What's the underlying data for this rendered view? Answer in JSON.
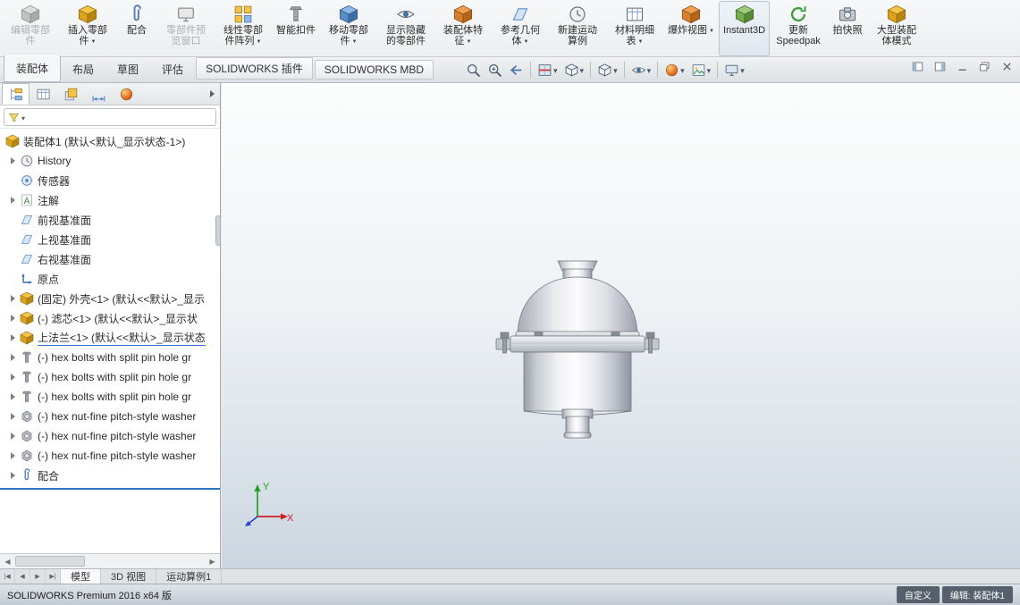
{
  "command_bar": {
    "buttons": [
      {
        "label": "编辑零部件",
        "icon": "edit-component-icon",
        "disabled": true,
        "dropdown": false
      },
      {
        "label": "插入零部件",
        "icon": "insert-component-icon",
        "disabled": false,
        "dropdown": true
      },
      {
        "label": "配合",
        "icon": "mate-icon",
        "disabled": false,
        "dropdown": false
      },
      {
        "label": "零部件预览窗口",
        "icon": "component-preview-window-icon",
        "disabled": true,
        "dropdown": false
      },
      {
        "label": "线性零部件阵列",
        "icon": "linear-component-pattern-icon",
        "disabled": false,
        "dropdown": true
      },
      {
        "label": "智能扣件",
        "icon": "smart-fasteners-icon",
        "disabled": false,
        "dropdown": false
      },
      {
        "label": "移动零部件",
        "icon": "move-component-icon",
        "disabled": false,
        "dropdown": true
      },
      {
        "label": "显示隐藏的零部件",
        "icon": "show-hidden-components-icon",
        "disabled": false,
        "dropdown": false
      },
      {
        "label": "装配体特征",
        "icon": "assembly-features-icon",
        "disabled": false,
        "dropdown": true
      },
      {
        "label": "参考几何体",
        "icon": "reference-geometry-icon",
        "disabled": false,
        "dropdown": true
      },
      {
        "label": "新建运动算例",
        "icon": "new-motion-study-icon",
        "disabled": false,
        "dropdown": false
      },
      {
        "label": "材料明细表",
        "icon": "bill-of-materials-icon",
        "disabled": false,
        "dropdown": true
      },
      {
        "label": "爆炸视图",
        "icon": "exploded-view-icon",
        "disabled": false,
        "dropdown": true
      },
      {
        "label": "Instant3D",
        "icon": "instant3d-icon",
        "disabled": false,
        "dropdown": false
      },
      {
        "label": "更新 Speedpak",
        "icon": "update-speedpak-icon",
        "disabled": false,
        "dropdown": false
      },
      {
        "label": "拍快照",
        "icon": "take-snapshot-icon",
        "disabled": false,
        "dropdown": false
      },
      {
        "label": "大型装配体模式",
        "icon": "large-assembly-mode-icon",
        "disabled": false,
        "dropdown": false
      }
    ]
  },
  "ribbon_tabs": {
    "items": [
      {
        "label": "装配体",
        "active": true
      },
      {
        "label": "布局",
        "active": false
      },
      {
        "label": "草图",
        "active": false
      },
      {
        "label": "评估",
        "active": false
      },
      {
        "label": "SOLIDWORKS 插件",
        "active": false
      },
      {
        "label": "SOLIDWORKS MBD",
        "active": false
      }
    ]
  },
  "headsup": {
    "icons": [
      {
        "name": "zoom-fit-icon",
        "dropdown": false
      },
      {
        "name": "zoom-area-icon",
        "dropdown": false
      },
      {
        "name": "previous-view-icon",
        "dropdown": false
      },
      {
        "name": "section-view-icon",
        "dropdown": true
      },
      {
        "name": "view-orientation-icon",
        "dropdown": true
      },
      {
        "name": "display-style-icon",
        "dropdown": true
      },
      {
        "name": "hide-show-items-icon",
        "dropdown": true
      },
      {
        "name": "edit-appearance-icon",
        "dropdown": true
      },
      {
        "name": "apply-scene-icon",
        "dropdown": true
      },
      {
        "name": "view-settings-icon",
        "dropdown": true
      }
    ]
  },
  "window_controls": [
    "pane-left-icon",
    "pane-right-icon",
    "minimize-icon",
    "restore-icon",
    "close-icon"
  ],
  "panel": {
    "tabs": [
      "featuremanager-tree",
      "propertymanager",
      "configurationmanager",
      "dimxpertmanager",
      "displaymanager"
    ],
    "filter": {
      "value": ""
    },
    "tree": {
      "root": {
        "label": "装配体1 (默认<默认_显示状态-1>)"
      },
      "items": [
        {
          "label": "History"
        },
        {
          "label": "传感器"
        },
        {
          "label": "注解"
        },
        {
          "label": "前视基准面"
        },
        {
          "label": "上视基准面"
        },
        {
          "label": "右视基准面"
        },
        {
          "label": "原点"
        },
        {
          "label": "(固定) 外壳<1> (默认<<默认>_显示"
        },
        {
          "label": "(-) 滤芯<1> (默认<<默认>_显示状"
        },
        {
          "label": "上法兰<1> (默认<<默认>_显示状态"
        },
        {
          "label": "(-) hex bolts with split pin hole gr"
        },
        {
          "label": "(-) hex bolts with split pin hole gr"
        },
        {
          "label": "(-) hex bolts with split pin hole gr"
        },
        {
          "label": "(-) hex nut-fine pitch-style washer"
        },
        {
          "label": "(-) hex nut-fine pitch-style washer"
        },
        {
          "label": "(-) hex nut-fine pitch-style washer"
        },
        {
          "label": "配合"
        }
      ]
    }
  },
  "viewport": {
    "triad": {
      "x_label": "X",
      "y_label": "Y"
    }
  },
  "bottom_bar": {
    "nav": [
      "|◀",
      "◀",
      "▶",
      "▶|"
    ],
    "tabs": [
      {
        "label": "模型",
        "active": true
      },
      {
        "label": "3D 视图",
        "active": false
      },
      {
        "label": "运动算例1",
        "active": false
      }
    ]
  },
  "status_bar": {
    "left": "SOLIDWORKS Premium 2016 x64 版",
    "right": [
      "自定义",
      "编辑: 装配体1"
    ]
  },
  "colors": {
    "axis_x": "#cc2222",
    "axis_y": "#22a022",
    "axis_z": "#2244cc",
    "viewport_gradient_top": "#fcfdfd",
    "viewport_gradient_bottom": "#ccd6e0",
    "tree_underline": "#2f74c9"
  }
}
